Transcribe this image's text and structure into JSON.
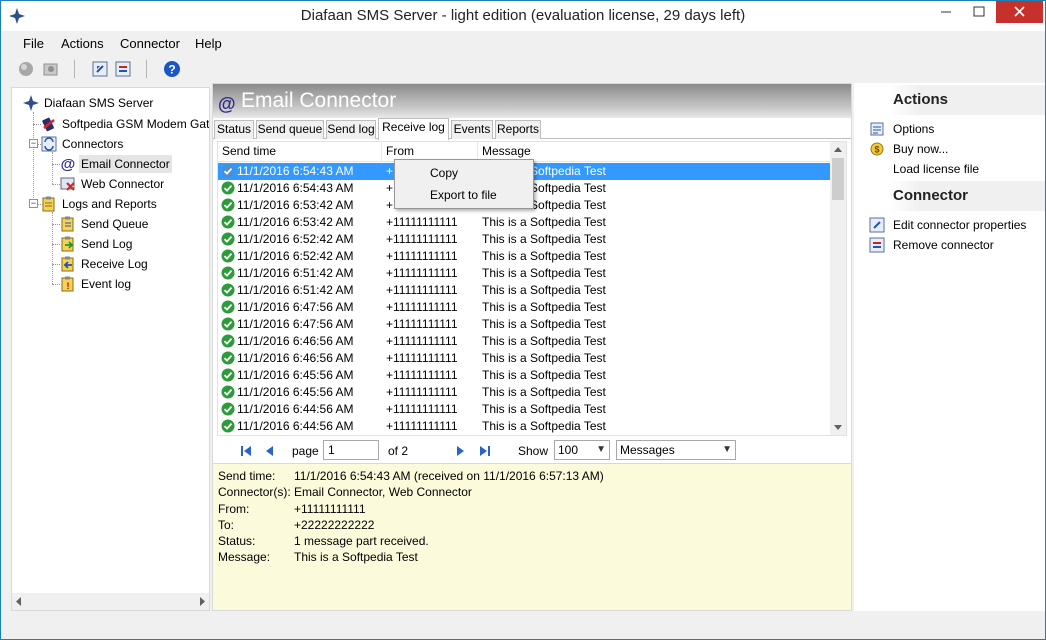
{
  "window": {
    "title": "Diafaan SMS Server - light edition (evaluation license, 29 days left)"
  },
  "menu": {
    "file": "File",
    "actions": "Actions",
    "connector": "Connector",
    "help": "Help"
  },
  "toolbar": {
    "icons": [
      "connect-icon",
      "settings-icon",
      "edit-connector-icon",
      "remove-connector-icon",
      "help-icon"
    ]
  },
  "tree": {
    "root": "Diafaan SMS Server",
    "gateway": "Softpedia GSM Modem Gateway",
    "connectors": "Connectors",
    "email_connector": "Email Connector",
    "web_connector": "Web Connector",
    "logs_reports": "Logs and Reports",
    "send_queue": "Send Queue",
    "send_log": "Send Log",
    "receive_log": "Receive Log",
    "event_log": "Event log"
  },
  "header": {
    "at_symbol": "@",
    "title": "Email Connector"
  },
  "tabs": [
    "Status",
    "Send queue",
    "Send log",
    "Receive log",
    "Events",
    "Reports"
  ],
  "grid": {
    "columns": [
      "Send time",
      "From",
      "Message"
    ],
    "rows": [
      {
        "time": "11/1/2016 6:54:43 AM",
        "from": "+11111111111",
        "message": "This is a Softpedia Test"
      },
      {
        "time": "11/1/2016 6:54:43 AM",
        "from": "+11111111111",
        "message": "This is a Softpedia Test"
      },
      {
        "time": "11/1/2016 6:53:42 AM",
        "from": "+11111111111",
        "message": "This is a Softpedia Test"
      },
      {
        "time": "11/1/2016 6:53:42 AM",
        "from": "+11111111111",
        "message": "This is a Softpedia Test"
      },
      {
        "time": "11/1/2016 6:52:42 AM",
        "from": "+11111111111",
        "message": "This is a Softpedia Test"
      },
      {
        "time": "11/1/2016 6:52:42 AM",
        "from": "+11111111111",
        "message": "This is a Softpedia Test"
      },
      {
        "time": "11/1/2016 6:51:42 AM",
        "from": "+11111111111",
        "message": "This is a Softpedia Test"
      },
      {
        "time": "11/1/2016 6:51:42 AM",
        "from": "+11111111111",
        "message": "This is a Softpedia Test"
      },
      {
        "time": "11/1/2016 6:47:56 AM",
        "from": "+11111111111",
        "message": "This is a Softpedia Test"
      },
      {
        "time": "11/1/2016 6:47:56 AM",
        "from": "+11111111111",
        "message": "This is a Softpedia Test"
      },
      {
        "time": "11/1/2016 6:46:56 AM",
        "from": "+11111111111",
        "message": "This is a Softpedia Test"
      },
      {
        "time": "11/1/2016 6:46:56 AM",
        "from": "+11111111111",
        "message": "This is a Softpedia Test"
      },
      {
        "time": "11/1/2016 6:45:56 AM",
        "from": "+11111111111",
        "message": "This is a Softpedia Test"
      },
      {
        "time": "11/1/2016 6:45:56 AM",
        "from": "+11111111111",
        "message": "This is a Softpedia Test"
      },
      {
        "time": "11/1/2016 6:44:56 AM",
        "from": "+11111111111",
        "message": "This is a Softpedia Test"
      },
      {
        "time": "11/1/2016 6:44:56 AM",
        "from": "+11111111111",
        "message": "This is a Softpedia Test"
      }
    ]
  },
  "context_menu": {
    "copy": "Copy",
    "export": "Export to file"
  },
  "pager": {
    "page_label": "page",
    "page_value": "1",
    "of_label": "of 2",
    "show_label": "Show",
    "show_value": "100",
    "type_value": "Messages"
  },
  "details": {
    "send_time_label": "Send time:",
    "send_time_value": "11/1/2016 6:54:43 AM (received on 11/1/2016 6:57:13 AM)",
    "connectors_label": "Connector(s):",
    "connectors_value": "Email Connector, Web Connector",
    "from_label": "From:",
    "from_value": "+11111111111",
    "to_label": "To:",
    "to_value": "+22222222222",
    "status_label": "Status:",
    "status_value": "1 message part received.",
    "message_label": "Message:",
    "message_value": "This is a Softpedia Test"
  },
  "actions": {
    "title": "Actions",
    "options": "Options",
    "buy": "Buy now...",
    "load_license": "Load license file"
  },
  "connector_panel": {
    "title": "Connector",
    "edit": "Edit connector properties",
    "remove": "Remove connector"
  },
  "colors": {
    "selection": "#3399ff",
    "details_bg": "#fbfbdc",
    "close_button": "#c7312b",
    "check_green": "#2e9b3a"
  }
}
